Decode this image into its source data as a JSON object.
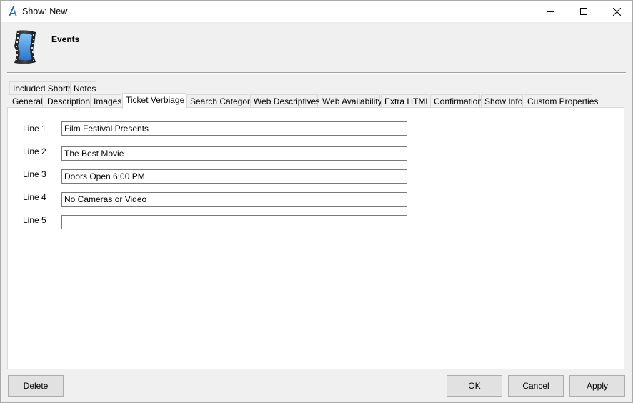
{
  "window": {
    "title": "Show: New",
    "header_title": "Events"
  },
  "tabs_row1": [
    "Included Shorts",
    "Notes"
  ],
  "tabs_row2": [
    "General",
    "Description",
    "Images",
    "Ticket Verbiage",
    "Search Category",
    "Web Descriptives",
    "Web Availability",
    "Extra HTML",
    "Confirmation",
    "Show Info",
    "Custom Properties"
  ],
  "active_tab": "Ticket Verbiage",
  "lines": [
    {
      "label": "Line 1",
      "value": "Film Festival Presents"
    },
    {
      "label": "Line 2",
      "value": "The Best Movie"
    },
    {
      "label": "Line 3",
      "value": "Doors Open 6:00 PM"
    },
    {
      "label": "Line 4",
      "value": "No Cameras or Video"
    },
    {
      "label": "Line 5",
      "value": ""
    }
  ],
  "buttons": {
    "delete": "Delete",
    "ok": "OK",
    "cancel": "Cancel",
    "apply": "Apply"
  },
  "icons": {
    "app": "app-logo-icon",
    "header": "film-strip-icon",
    "minimize": "minimize-icon",
    "maximize": "maximize-icon",
    "close": "close-icon"
  }
}
